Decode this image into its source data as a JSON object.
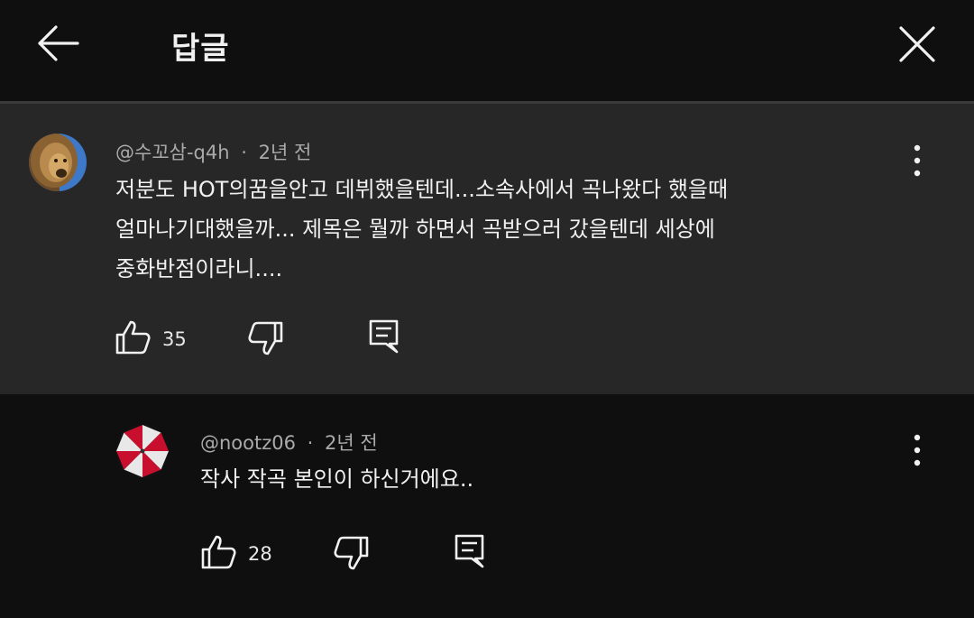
{
  "header": {
    "title": "답글",
    "back_icon": "arrow-left-icon",
    "close_icon": "close-icon"
  },
  "parent_comment": {
    "author": "@수꼬삼-q4h",
    "separator": "·",
    "time": "2년 전",
    "lines": [
      "저분도 HOT의꿈을안고 데뷔했을텐데...소속사에서 곡나왔다 했을때",
      "얼마나기대했을까... 제목은 뭘까 하면서 곡받으러 갔을텐데 세상에",
      "중화반점이라니...."
    ],
    "like_count": "35"
  },
  "reply_comment": {
    "author": "@nootz06",
    "separator": "·",
    "time": "2년 전",
    "text": "작사 작곡 본인이 하신거에요..",
    "like_count": "28"
  },
  "colors": {
    "background": "#0f0f0f",
    "highlight_background": "#272727",
    "text": "#f1f1f1",
    "secondary_text": "#aaaaaa"
  }
}
